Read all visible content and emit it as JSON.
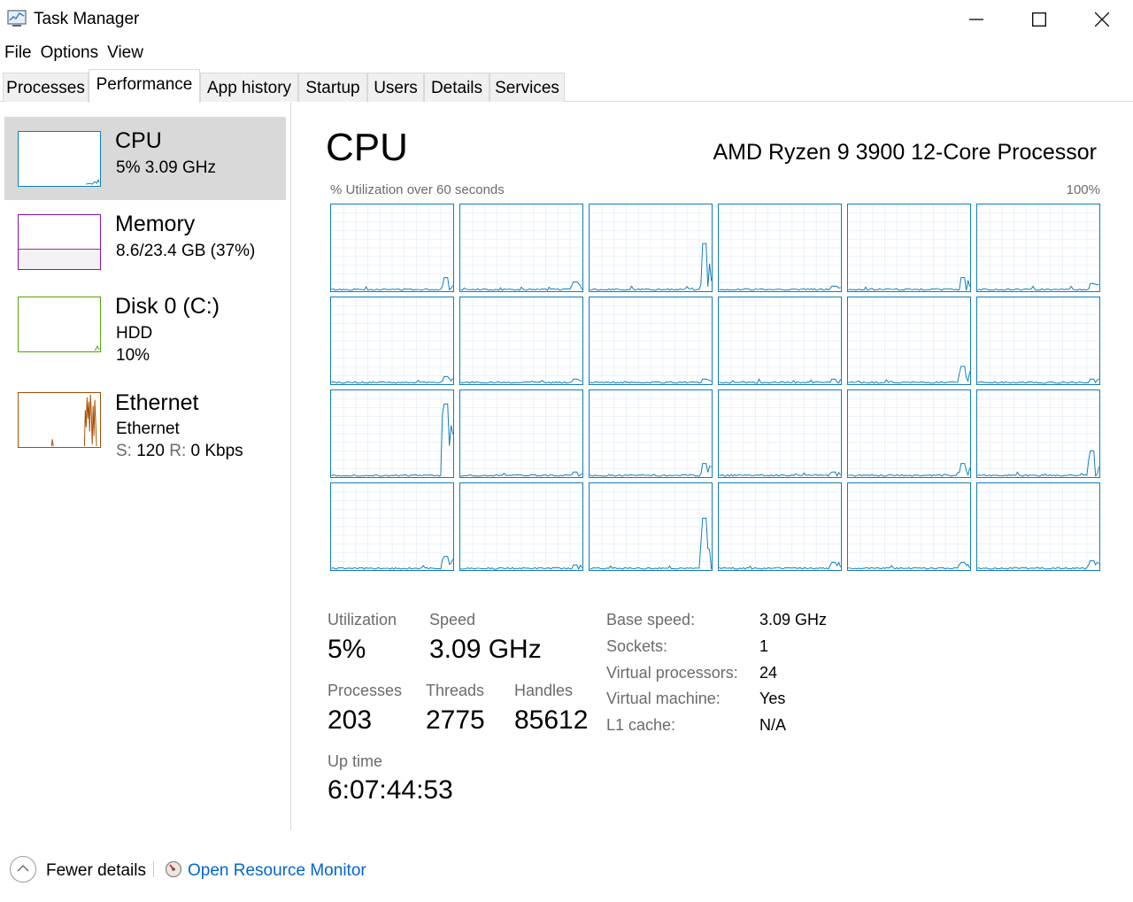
{
  "window": {
    "title": "Task Manager",
    "icons": [
      "task-manager-icon",
      "minimize-icon",
      "maximize-icon",
      "close-icon"
    ]
  },
  "menu": [
    "File",
    "Options",
    "View"
  ],
  "tabs": [
    "Processes",
    "Performance",
    "App history",
    "Startup",
    "Users",
    "Details",
    "Services"
  ],
  "active_tab": "Performance",
  "sidebar": {
    "items": [
      {
        "title": "CPU",
        "sub1": "5%  3.09 GHz",
        "color": "#117dbb",
        "selected": true
      },
      {
        "title": "Memory",
        "sub1": "8.6/23.4 GB (37%)",
        "color": "#8b12ae",
        "fill_fraction": 0.37
      },
      {
        "title": "Disk 0 (C:)",
        "sub1": "HDD",
        "sub2": "10%",
        "color": "#4da60c"
      },
      {
        "title": "Ethernet",
        "sub1": "Ethernet",
        "send_label": "S:",
        "send_value": "120",
        "recv_label": "R:",
        "recv_value": "0 Kbps",
        "color": "#a74f01"
      }
    ]
  },
  "main": {
    "title": "CPU",
    "processor": "AMD Ryzen 9 3900 12-Core Processor",
    "graph_label": "% Utilization over 60 seconds",
    "graph_max": "100%",
    "core_count": 24,
    "core_peaks": [
      0.15,
      0.1,
      0.55,
      0.05,
      0.15,
      0.08,
      0.08,
      0.05,
      0.05,
      0.05,
      0.2,
      0.05,
      0.85,
      0.05,
      0.15,
      0.05,
      0.15,
      0.3,
      0.15,
      0.05,
      0.6,
      0.08,
      0.08,
      0.1
    ],
    "graph_color": "#117dbb"
  },
  "stats": {
    "utilization_label": "Utilization",
    "utilization": "5%",
    "speed_label": "Speed",
    "speed": "3.09 GHz",
    "processes_label": "Processes",
    "processes": "203",
    "threads_label": "Threads",
    "threads": "2775",
    "handles_label": "Handles",
    "handles": "85612",
    "uptime_label": "Up time",
    "uptime": "6:07:44:53"
  },
  "details": [
    {
      "key": "Base speed:",
      "value": "3.09 GHz"
    },
    {
      "key": "Sockets:",
      "value": "1"
    },
    {
      "key": "Virtual processors:",
      "value": "24"
    },
    {
      "key": "Virtual machine:",
      "value": "Yes"
    },
    {
      "key": "L1 cache:",
      "value": "N/A"
    }
  ],
  "footer": {
    "fewer_details": "Fewer details",
    "resource_monitor": "Open Resource Monitor"
  }
}
